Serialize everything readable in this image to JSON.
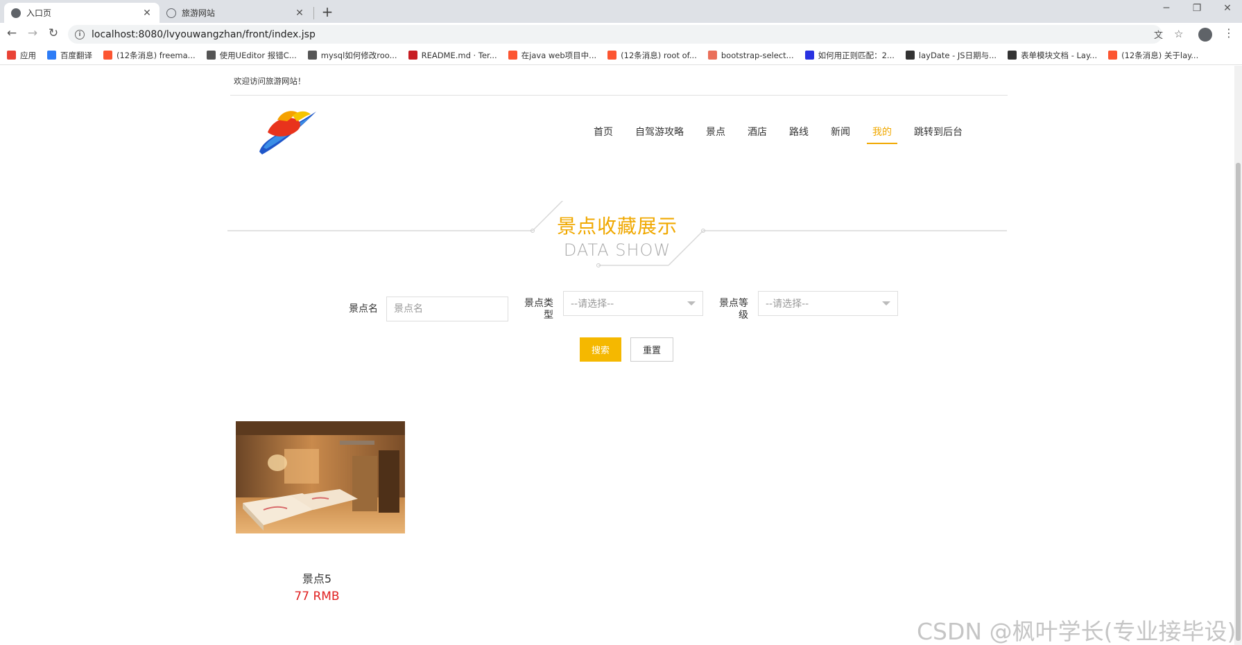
{
  "browser": {
    "tabs": [
      {
        "title": "入口页",
        "active": true
      },
      {
        "title": "旅游网站",
        "active": false
      }
    ],
    "url": "localhost:8080/lvyouwangzhan/front/index.jsp",
    "bookmarks": [
      {
        "label": "应用",
        "icon": "apps-grid-icon",
        "color": "#e94235"
      },
      {
        "label": "百度翻译",
        "icon": "baidu-translate-icon",
        "color": "#2d7cf6"
      },
      {
        "label": "(12条消息) freema...",
        "icon": "csdn-icon",
        "color": "#fc5531"
      },
      {
        "label": "使用UEditor 报错C...",
        "icon": "ueditor-icon",
        "color": "#555555"
      },
      {
        "label": "mysql如何修改roo...",
        "icon": "ueditor-icon",
        "color": "#555555"
      },
      {
        "label": "README.md · Ter...",
        "icon": "gitee-icon",
        "color": "#c71d23"
      },
      {
        "label": "在java web项目中...",
        "icon": "csdn-icon",
        "color": "#fc5531"
      },
      {
        "label": "(12条消息) root of...",
        "icon": "csdn-icon",
        "color": "#fc5531"
      },
      {
        "label": "bootstrap-select...",
        "icon": "jianshu-icon",
        "color": "#ea6f5a"
      },
      {
        "label": "如何用正则匹配：2...",
        "icon": "baidu-paw-icon",
        "color": "#2932e1"
      },
      {
        "label": "layDate - JS日期与...",
        "icon": "layui-icon",
        "color": "#333333"
      },
      {
        "label": "表单模块文档 - Lay...",
        "icon": "layui-icon",
        "color": "#333333"
      },
      {
        "label": "(12条消息) 关于lay...",
        "icon": "csdn-icon",
        "color": "#fc5531"
      }
    ]
  },
  "header": {
    "welcome": "欢迎访问旅游网站！",
    "nav": [
      {
        "label": "首页",
        "active": false
      },
      {
        "label": "自驾游攻略",
        "active": false
      },
      {
        "label": "景点",
        "active": false
      },
      {
        "label": "酒店",
        "active": false
      },
      {
        "label": "路线",
        "active": false
      },
      {
        "label": "新闻",
        "active": false
      },
      {
        "label": "我的",
        "active": true
      },
      {
        "label": "跳转到后台",
        "active": false
      }
    ],
    "accent_color": "#f0a800"
  },
  "section": {
    "title_cn": "景点收藏展示",
    "title_en": "DATA SHOW"
  },
  "search": {
    "name_label": "景点名",
    "name_placeholder": "景点名",
    "type_label": "景点类型",
    "type_value": "--请选择--",
    "level_label": "景点等级",
    "level_value": "--请选择--",
    "search_button": "搜索",
    "reset_button": "重置"
  },
  "cards": [
    {
      "name": "景点5",
      "price": "77 RMB",
      "image": "hotel-room-photo"
    }
  ],
  "watermark": "CSDN @枫叶学长(专业接毕设)"
}
